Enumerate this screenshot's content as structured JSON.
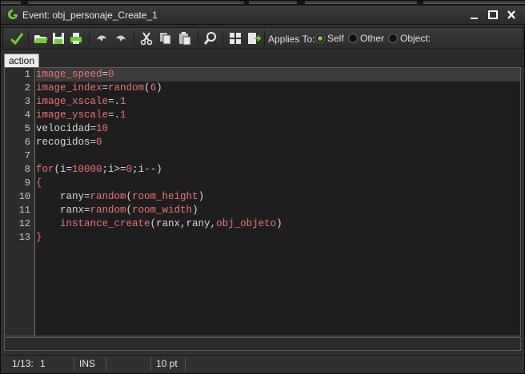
{
  "window": {
    "title": "Event: obj_personaje_Create_1",
    "min_label": "_",
    "max_label": "□",
    "close_label": "✕"
  },
  "toolbar": {
    "icons": [
      "check-icon",
      "open-folder-icon",
      "save-icon",
      "print-icon",
      "undo-icon",
      "redo-icon",
      "cut-icon",
      "copy-icon",
      "paste-icon",
      "find-icon",
      "grid-icon",
      "export-icon"
    ],
    "applies_label": "Applies To:",
    "options": [
      {
        "label": "Self",
        "selected": true
      },
      {
        "label": "Other",
        "selected": false
      },
      {
        "label": "Object:",
        "selected": false
      }
    ]
  },
  "tab": {
    "label": "action"
  },
  "editor": {
    "current_line": 1,
    "lines": [
      "image_speed=0",
      "image_index=random(6)",
      "image_xscale=.1",
      "image_yscale=.1",
      "velocidad=10",
      "recogidos=0",
      "",
      "for(i=10000;i>=0;i--)",
      "{",
      "    rany=random(room_height)",
      "    ranx=random(room_width)",
      "    instance_create(ranx,rany,obj_objeto)",
      "}"
    ]
  },
  "status": {
    "position": "1/13:",
    "column": "1",
    "mode": "INS",
    "font_size": "10 pt"
  },
  "colors": {
    "accent": "#6cd12a",
    "keyword": "#f07070"
  }
}
